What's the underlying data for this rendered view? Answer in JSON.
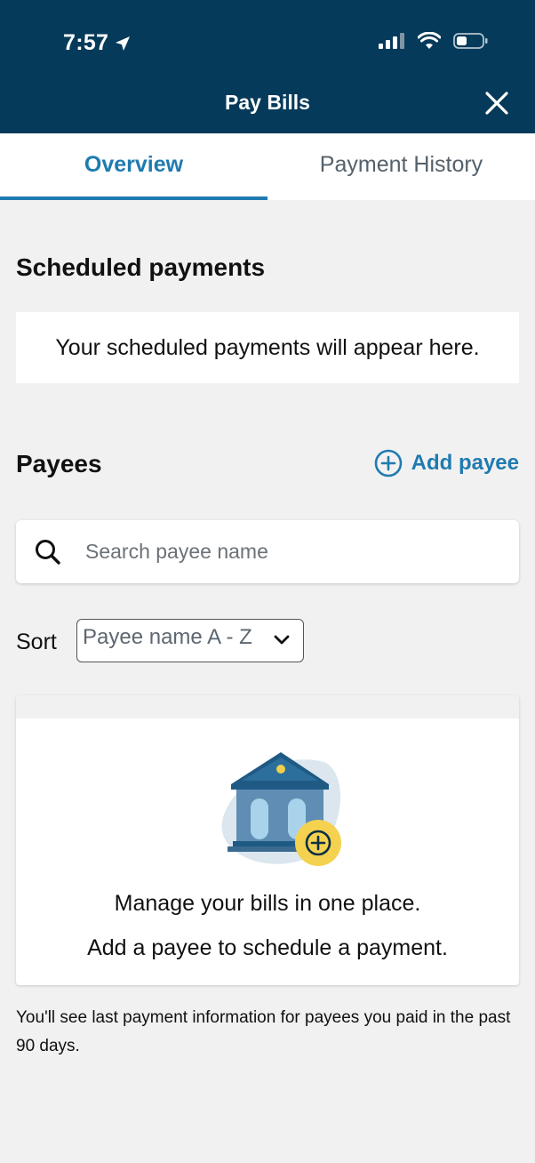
{
  "status_bar": {
    "time": "7:57",
    "icons": [
      "location-arrow-icon",
      "signal-icon",
      "wifi-icon",
      "battery-icon"
    ]
  },
  "header": {
    "title": "Pay Bills",
    "close_icon": "close-icon"
  },
  "tabs": [
    {
      "label": "Overview",
      "active": true
    },
    {
      "label": "Payment History",
      "active": false
    }
  ],
  "scheduled": {
    "title": "Scheduled payments",
    "empty_message": "Your scheduled payments will appear here."
  },
  "payees": {
    "title": "Payees",
    "add_label": "Add payee",
    "search_placeholder": "Search payee name",
    "sort_label": "Sort",
    "sort_value": "Payee name A - Z",
    "empty_line1": "Manage your bills in one place.",
    "empty_line2": "Add a payee to schedule a payment."
  },
  "footnote": "You'll see last payment information for payees you paid in the past 90 days.",
  "colors": {
    "header_bg": "#063a5a",
    "accent": "#1f7bb0",
    "page_bg": "#f2f1f2"
  }
}
